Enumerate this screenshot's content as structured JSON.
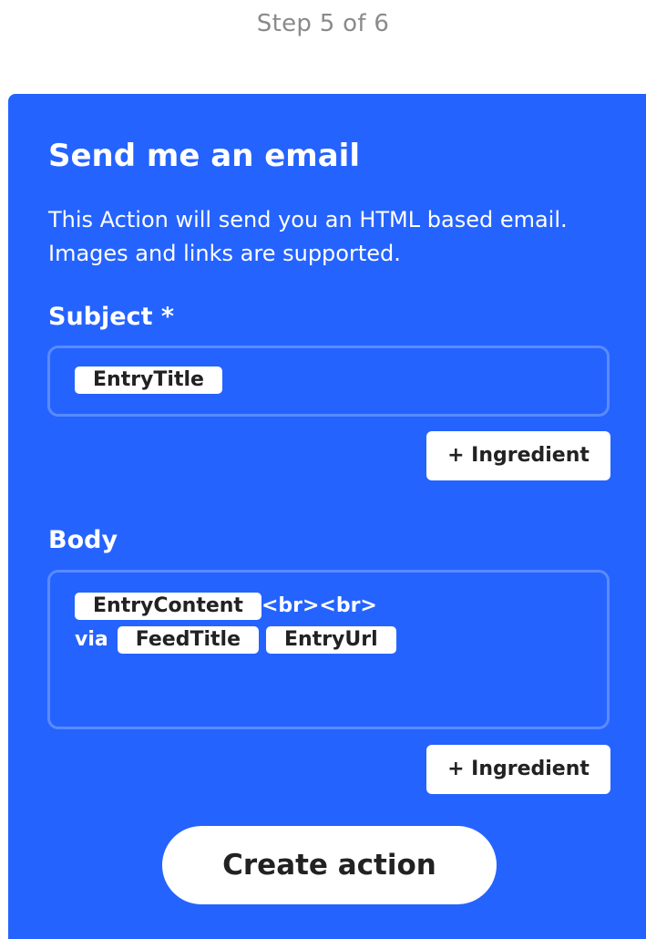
{
  "header": {
    "step": "Step 5 of 6"
  },
  "card": {
    "title": "Send me an email",
    "description": "This Action will send you an HTML based email. Images and links are supported.",
    "background_color": "#2563ff"
  },
  "subject": {
    "label": "Subject *",
    "ingredients": [
      "EntryTitle"
    ],
    "add_ingredient_label": "+ Ingredient"
  },
  "body": {
    "label": "Body",
    "line1": {
      "ingredient": "EntryContent",
      "text": "<br><br>"
    },
    "line2": {
      "text": "via",
      "ingredients": [
        "FeedTitle",
        "EntryUrl"
      ]
    },
    "add_ingredient_label": "+ Ingredient"
  },
  "actions": {
    "create_label": "Create action"
  }
}
